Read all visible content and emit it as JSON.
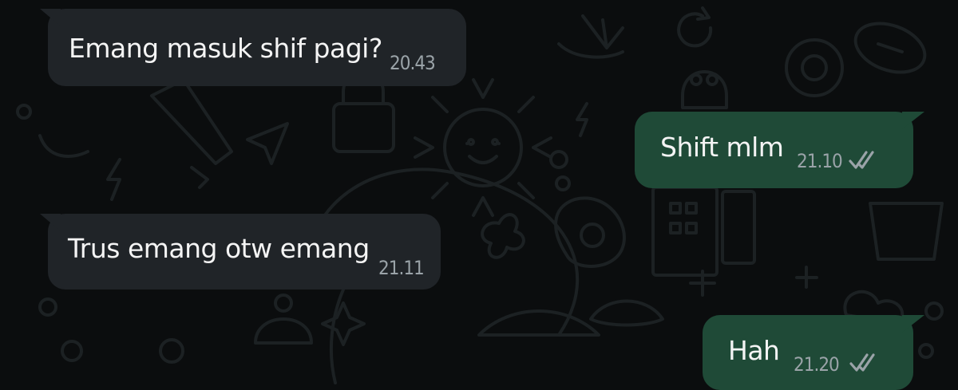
{
  "chat": {
    "messages": [
      {
        "direction": "incoming",
        "text": "Emang masuk shif pagi?",
        "time": "20.43"
      },
      {
        "direction": "outgoing",
        "text": "Shift mlm",
        "time": "21.10",
        "status": "read-double-check-icon"
      },
      {
        "direction": "incoming",
        "text": "Trus emang otw emang",
        "time": "21.11"
      },
      {
        "direction": "outgoing",
        "text": "Hah",
        "time": "21.20",
        "status": "read-double-check-icon"
      }
    ]
  },
  "colors": {
    "background": "#0b0d0e",
    "incoming_bubble": "#202428",
    "outgoing_bubble": "#1f4a37",
    "time_text": "#9aa3a8",
    "wallpaper_doodle": "#1c2123"
  }
}
